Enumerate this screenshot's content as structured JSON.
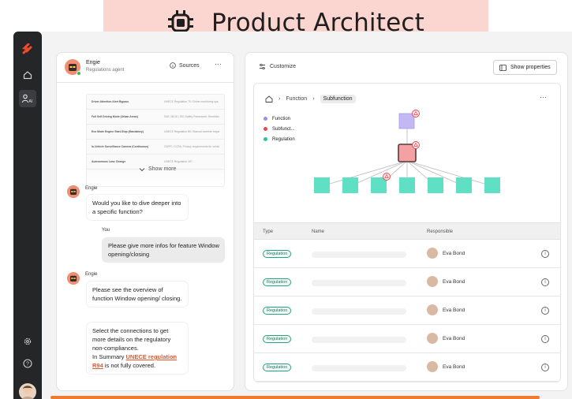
{
  "banner": {
    "title": "Product Architect",
    "icon": "chip-icon"
  },
  "sidebar": {
    "items": [
      {
        "icon": "logo-icon"
      },
      {
        "icon": "home-icon"
      },
      {
        "icon": "ai-agent-icon",
        "label": "AI"
      },
      {
        "icon": "settings-icon"
      },
      {
        "icon": "help-icon"
      }
    ]
  },
  "chat": {
    "agent_name": "Engie",
    "agent_role": "Regulations agent",
    "sources_label": "Sources",
    "more": "···",
    "documents": [
      {
        "title": "Driver Attention Alert Bypass",
        "detail": "UNECE Regulation 79 / Driver monitoring sys..."
      },
      {
        "title": "Full Self Driving Mode (Urban Areas)",
        "detail": "SAE J3016 / ISO Safety Framework: Restrictions o..."
      },
      {
        "title": "Eco Mode Engine Start-Stop (Mandatory)",
        "detail": "UNECE Regulation 85 / Manual override requir..."
      },
      {
        "title": "In-Vehicle Surveillance Camera (Continuous)",
        "detail": "GDPR / CCPA: Privacy requirements for vehicl..."
      },
      {
        "title": "Autonomous Lane Change",
        "detail": "UNECE Regulation 157..."
      }
    ],
    "show_more": "Show more",
    "messages": [
      {
        "author": "Engie",
        "text": "Would you like to dive deeper into a specific function?"
      },
      {
        "author": "You",
        "text": "Please give more infos for feature Window opening/closing"
      },
      {
        "author": "Engie",
        "text": "Please see the overview of function Window opening/ closing."
      },
      {
        "text_before": "Select the connections to get more details on the regulatory non-compliances.",
        "summary_prefix": "In Summary ",
        "link": "UNECE regulation R94",
        "summary_suffix": " is not fully covered."
      }
    ]
  },
  "main": {
    "customize_label": "Customize",
    "show_properties_label": "Show properties",
    "breadcrumb": {
      "level1": "Function",
      "level2": "Subfunction"
    },
    "more": "···",
    "legend": [
      {
        "label": "Function",
        "color": "#9d8fe8"
      },
      {
        "label": "Subfunct...",
        "color": "#e6464d"
      },
      {
        "label": "Regulation",
        "color": "#2fbf9b"
      }
    ],
    "table": {
      "headers": {
        "type": "Type",
        "name": "Name",
        "responsible": "Responsible"
      },
      "rows": [
        {
          "type": "Regulation",
          "responsible": "Eva Bond"
        },
        {
          "type": "Regulation",
          "responsible": "Eva Bond"
        },
        {
          "type": "Regulation",
          "responsible": "Eva Bond"
        },
        {
          "type": "Regulation",
          "responsible": "Eva Bond"
        },
        {
          "type": "Regulation",
          "responsible": "Eva Bond"
        }
      ]
    }
  },
  "colors": {
    "accent": "#e4572e",
    "banner": "#fbd5cf",
    "sidebar": "#252628",
    "regulation": "#5fe0c4",
    "function": "#c3b8f4",
    "subfunction": "#f4a1a4"
  }
}
